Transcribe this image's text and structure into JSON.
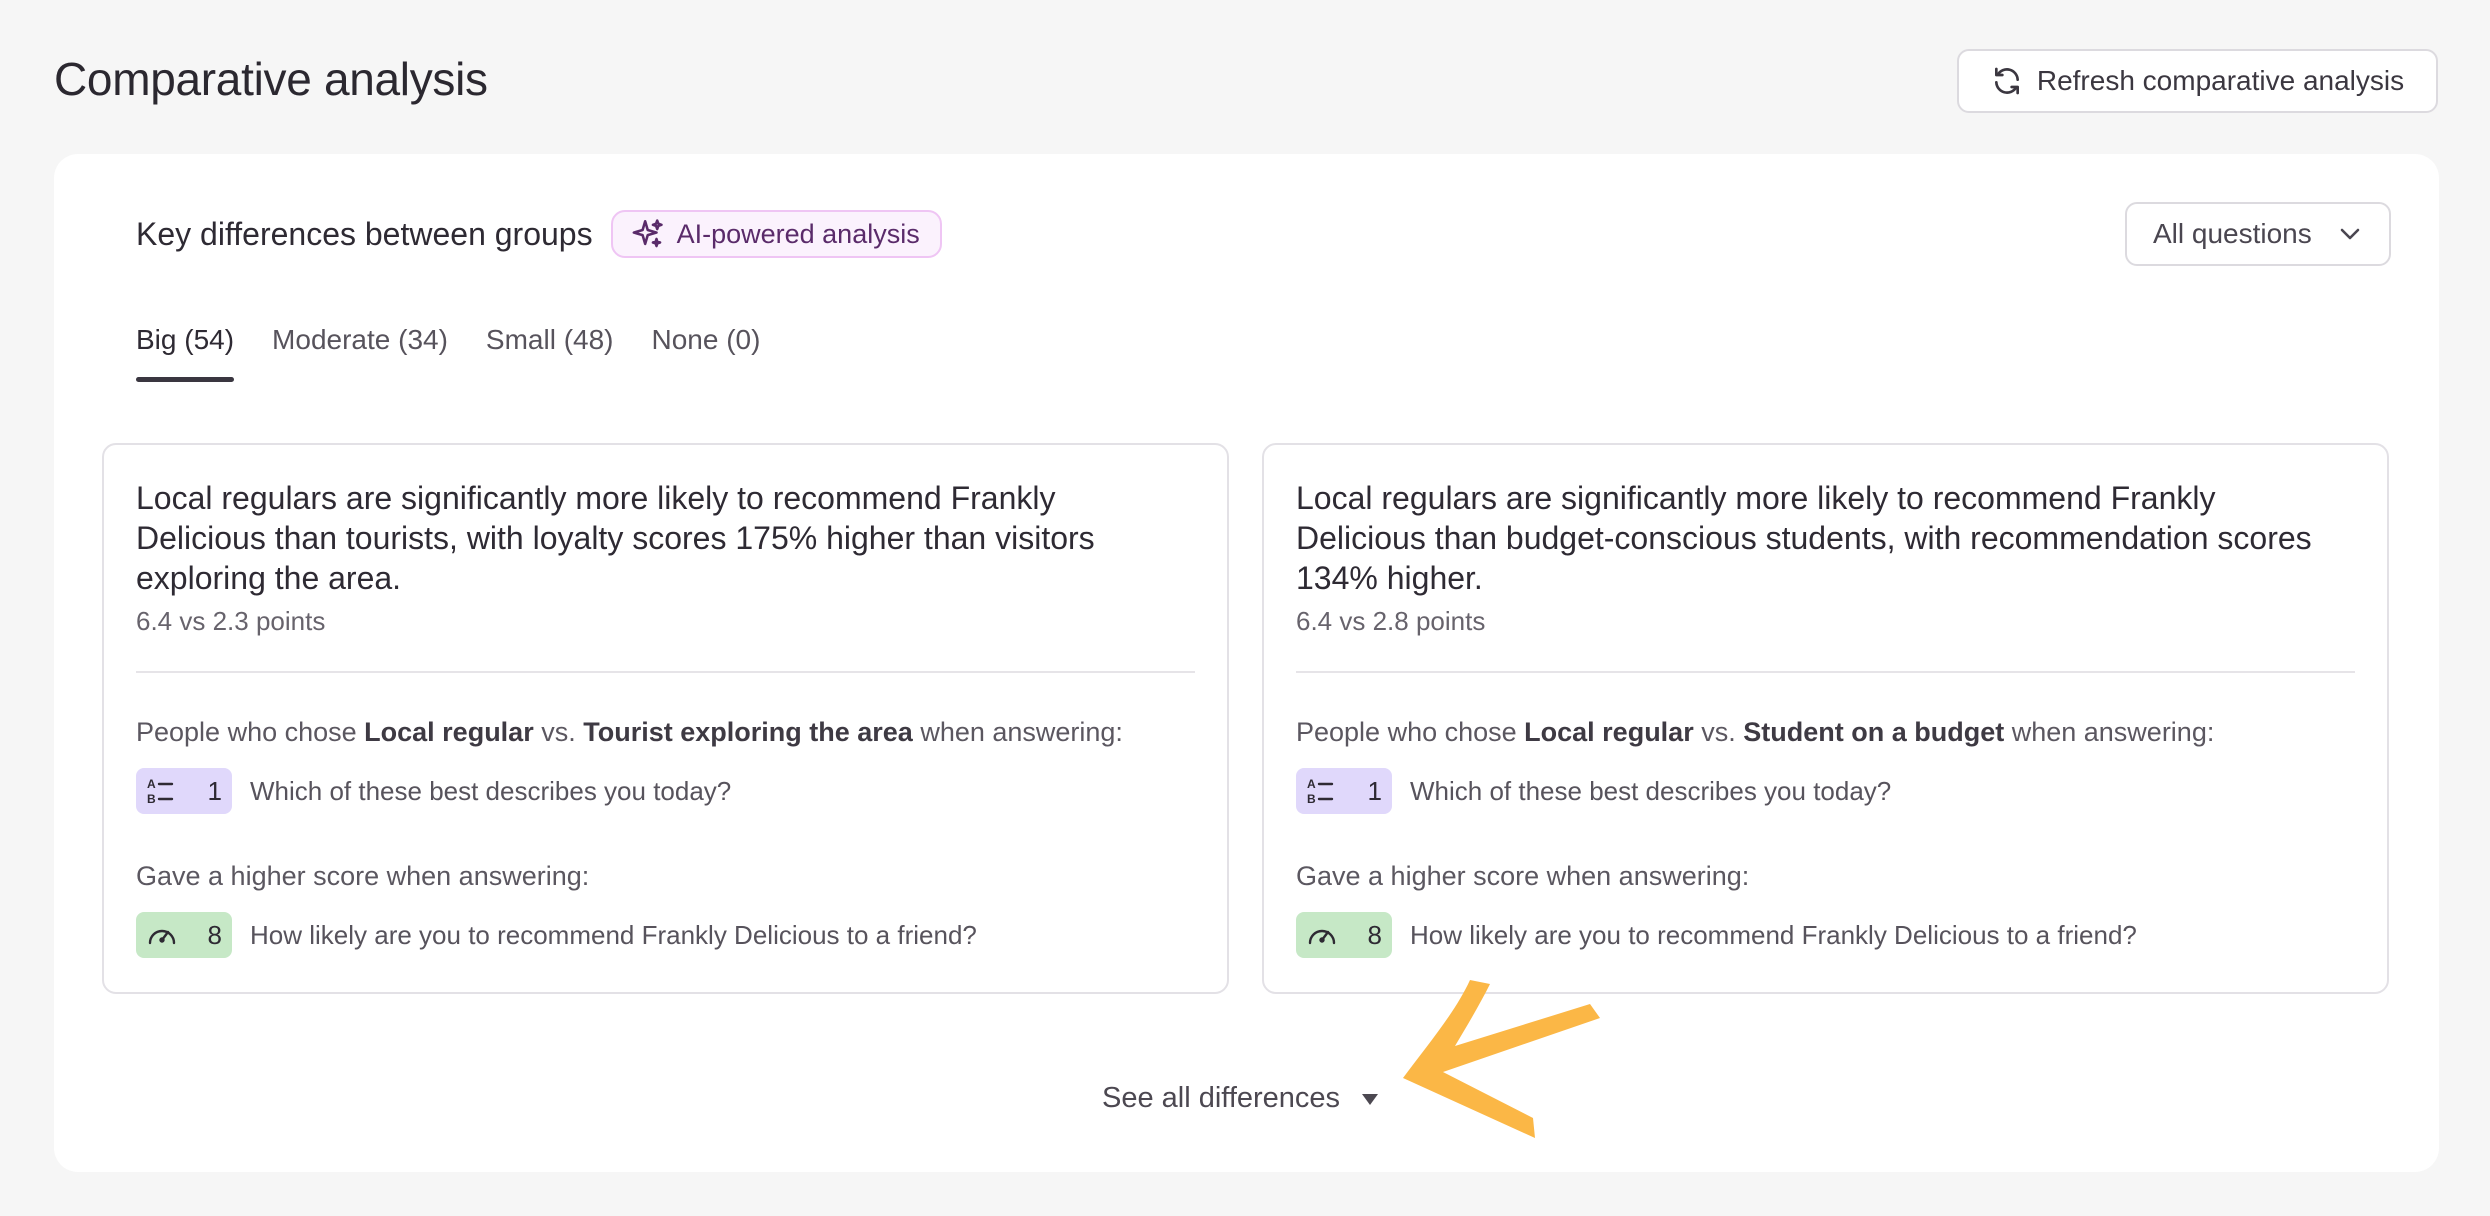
{
  "page": {
    "title": "Comparative analysis",
    "refresh_label": "Refresh comparative analysis"
  },
  "panel": {
    "title": "Key differences between groups",
    "ai_badge": "AI-powered analysis",
    "filter": "All questions"
  },
  "tabs": [
    {
      "label": "Big (54)",
      "active": true
    },
    {
      "label": "Moderate (34)",
      "active": false
    },
    {
      "label": "Small (48)",
      "active": false
    },
    {
      "label": "None (0)",
      "active": false
    }
  ],
  "cards": [
    {
      "headline": "Local regulars are significantly more likely to recommend Frankly Delicious than tourists, with loyalty scores 175% higher than visitors exploring the area.",
      "metric": "6.4 vs 2.3 points",
      "compare_prefix": "People who chose ",
      "group_a": "Local regular",
      "compare_vs": " vs. ",
      "group_b": "Tourist exploring the area",
      "compare_suffix": " when answering:",
      "question1_number": "1",
      "question1_text": "Which of these best describes you today?",
      "higher_label": "Gave a higher score when answering:",
      "question2_number": "8",
      "question2_text": "How likely are you to recommend Frankly Delicious to a friend?"
    },
    {
      "headline": "Local regulars are significantly more likely to recommend Frankly Delicious than budget-conscious students, with recommendation scores 134% higher.",
      "metric": "6.4 vs 2.8 points",
      "compare_prefix": "People who chose ",
      "group_a": "Local regular",
      "compare_vs": " vs. ",
      "group_b": "Student on a budget",
      "compare_suffix": " when answering:",
      "question1_number": "1",
      "question1_text": "Which of these best describes you today?",
      "higher_label": "Gave a higher score when answering:",
      "question2_number": "8",
      "question2_text": "How likely are you to recommend Frankly Delicious to a friend?"
    }
  ],
  "see_all": "See all differences",
  "colors": {
    "background": "#f6f6f6",
    "ai_badge_bg": "#fbf2fd",
    "choice_chip": "#e0d8fb",
    "score_chip": "#c6e8c6",
    "annotation_arrow": "#fbb746"
  },
  "icons": {
    "refresh": "refresh-icon",
    "ai": "sparkles-icon",
    "select": "chevron-down-icon",
    "choice": "multiple-choice-icon",
    "score": "gauge-icon",
    "expand": "caret-down-icon"
  }
}
